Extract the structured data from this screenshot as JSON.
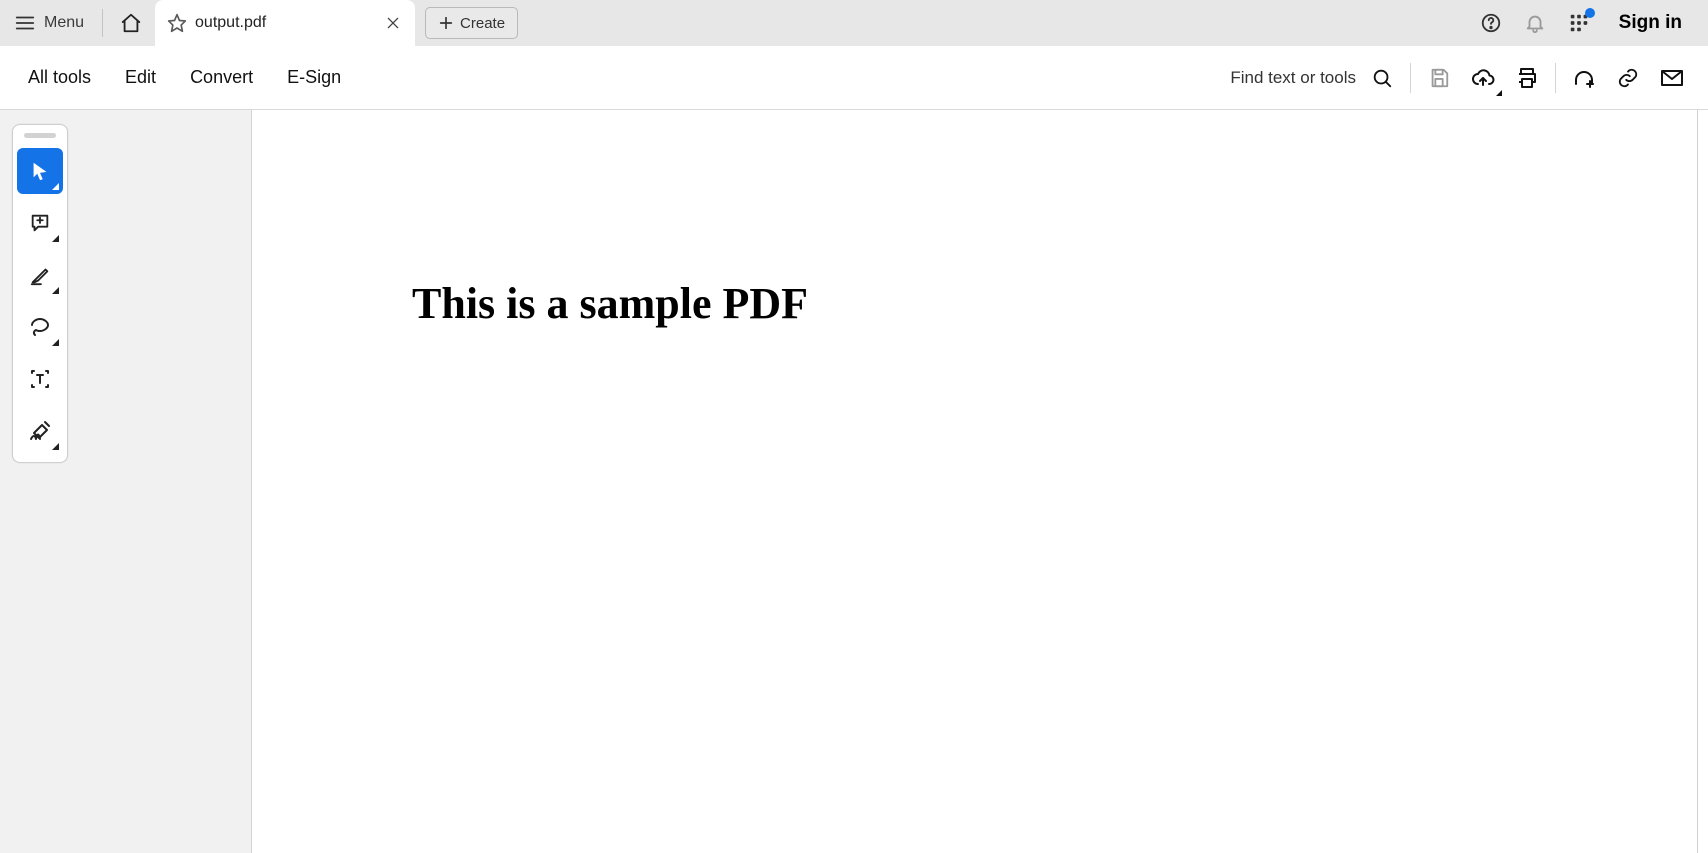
{
  "chrome": {
    "menu_label": "Menu",
    "tab_title": "output.pdf",
    "create_label": "Create",
    "sign_in_label": "Sign in"
  },
  "toolbar": {
    "items": [
      "All tools",
      "Edit",
      "Convert",
      "E-Sign"
    ],
    "search_hint": "Find text or tools"
  },
  "document": {
    "heading": "This is a sample PDF"
  }
}
